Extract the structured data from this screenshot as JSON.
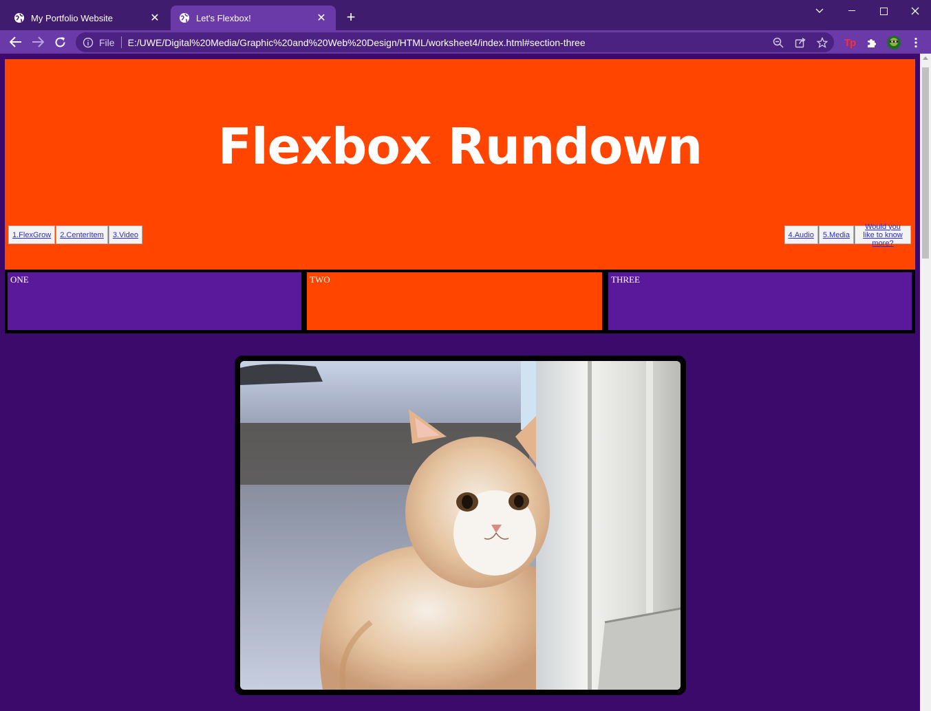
{
  "browser": {
    "tabs": [
      {
        "title": "My Portfolio Website",
        "active": false
      },
      {
        "title": "Let's Flexbox!",
        "active": true
      }
    ],
    "address": {
      "scheme_label": "File",
      "url": "E:/UWE/Digital%20Media/Graphic%20and%20Web%20Design/HTML/worksheet4/index.html#section-three"
    },
    "icons": [
      "back-arrow-icon",
      "forward-arrow-icon",
      "reload-icon",
      "info-icon",
      "zoom-out-icon",
      "share-icon",
      "star-icon",
      "extension-tp-icon",
      "puzzle-icon",
      "profile-avatar",
      "kebab-menu-icon"
    ],
    "colors": {
      "frame": "#3f1c6e",
      "toolbar": "#6a3aa8",
      "omnibox": "#4b2281"
    }
  },
  "page": {
    "hero": {
      "title": "Flexbox Rundown",
      "background": "#ff4500"
    },
    "nav_left": [
      "1.FlexGrow",
      "2.CenterItem",
      "3.Video"
    ],
    "nav_right": [
      "4.Audio",
      "5.Media",
      "Would you like to know more?"
    ],
    "boxes": [
      {
        "label": "ONE",
        "color": "#5a189a"
      },
      {
        "label": "TWO",
        "color": "#ff4500"
      },
      {
        "label": "THREE",
        "color": "#5a189a"
      }
    ],
    "image": {
      "subject": "kitten-photo"
    },
    "background": "#3b0a6b"
  }
}
